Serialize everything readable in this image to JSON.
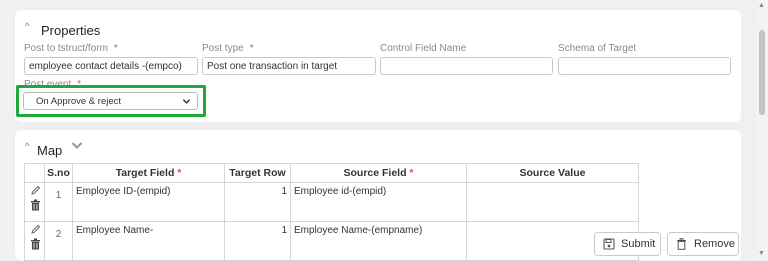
{
  "properties": {
    "title": "Properties",
    "fields": {
      "post_to": {
        "label": "Post to tstruct/form",
        "required": "*",
        "value": "employee contact details -(empco)"
      },
      "post_type": {
        "label": "Post type",
        "required": "*",
        "value": "Post one transaction in target"
      },
      "control_field": {
        "label": "Control Field Name",
        "value": ""
      },
      "schema": {
        "label": "Schema of Target",
        "value": ""
      },
      "post_event": {
        "label": "Post event",
        "required": "*",
        "value": "On Approve & reject"
      }
    }
  },
  "map": {
    "title": "Map",
    "columns": {
      "sno": "S.no",
      "target_field": "Target Field",
      "target_row": "Target Row",
      "source_field": "Source Field",
      "source_value": "Source Value",
      "required": "*"
    },
    "rows": [
      {
        "sno": "1",
        "target_field": "Employee ID-(empid)",
        "target_row": "1",
        "source_field": "Employee id-(empid)",
        "source_value": ""
      },
      {
        "sno": "2",
        "target_field": "Employee Name-",
        "target_row": "1",
        "source_field": "Employee Name-(empname)",
        "source_value": ""
      }
    ]
  },
  "actions": {
    "submit": "Submit",
    "remove": "Remove"
  },
  "colors": {
    "highlight": "#22a83a",
    "required": "#d9534f"
  },
  "icons": [
    "caret-up-icon",
    "chevron-down-icon",
    "edit-pencil-icon",
    "trash-icon",
    "save-icon",
    "trash-can-icon"
  ]
}
